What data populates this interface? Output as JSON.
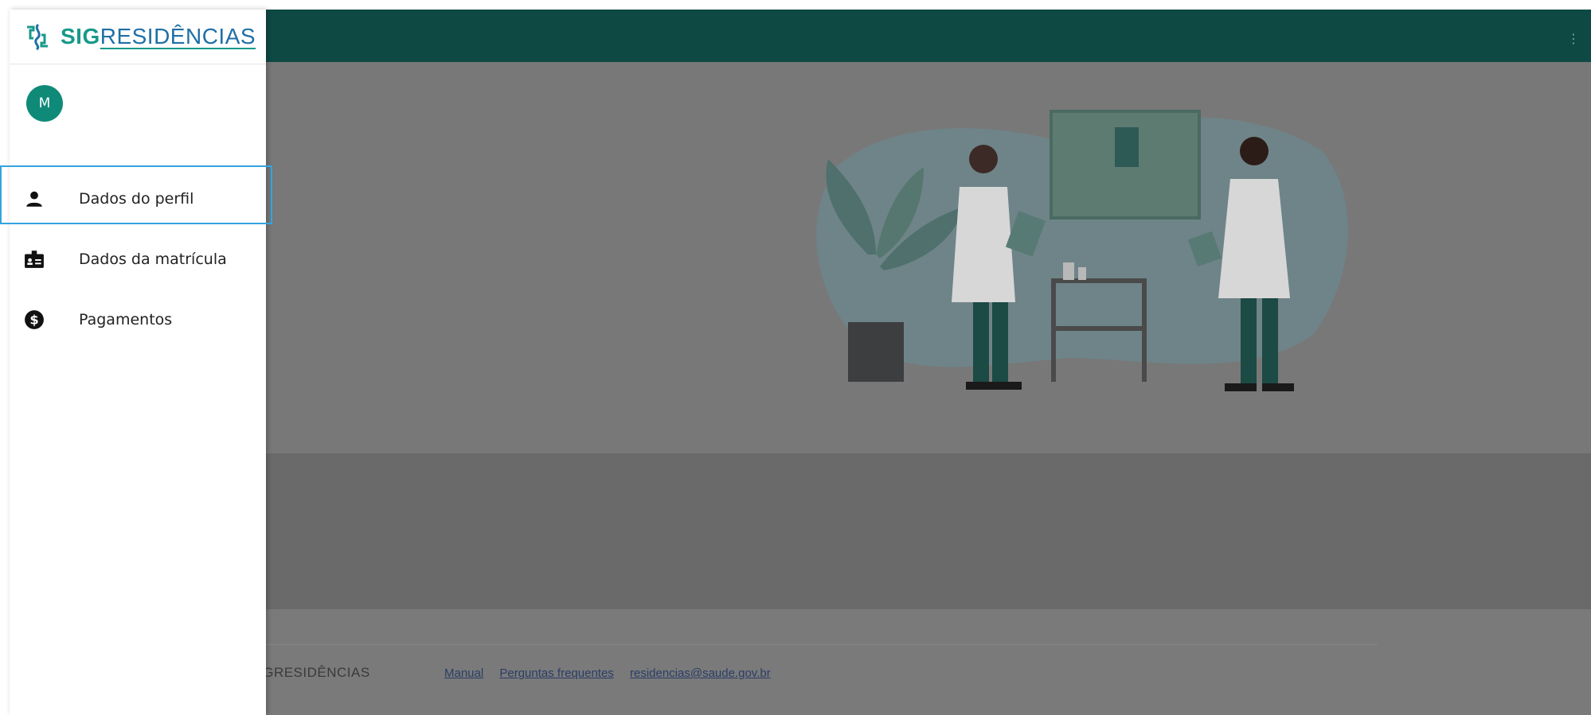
{
  "app": {
    "logo_sig": "SIG",
    "logo_res": "RESIDÊNCIAS",
    "user_initial": "M"
  },
  "nav": {
    "items": [
      {
        "label": "Dados do perfil",
        "icon": "person-icon"
      },
      {
        "label": "Dados da matrícula",
        "icon": "badge-icon"
      },
      {
        "label": "Pagamentos",
        "icon": "dollar-icon"
      }
    ]
  },
  "footer": {
    "brand": "IGRESIDÊNCIAS",
    "links": [
      "Manual",
      "Perguntas frequentes",
      "residencias@saude.gov.br"
    ]
  },
  "colors": {
    "topbar": "#0f4944",
    "accent": "#17998a",
    "focus": "#33a4e0"
  }
}
